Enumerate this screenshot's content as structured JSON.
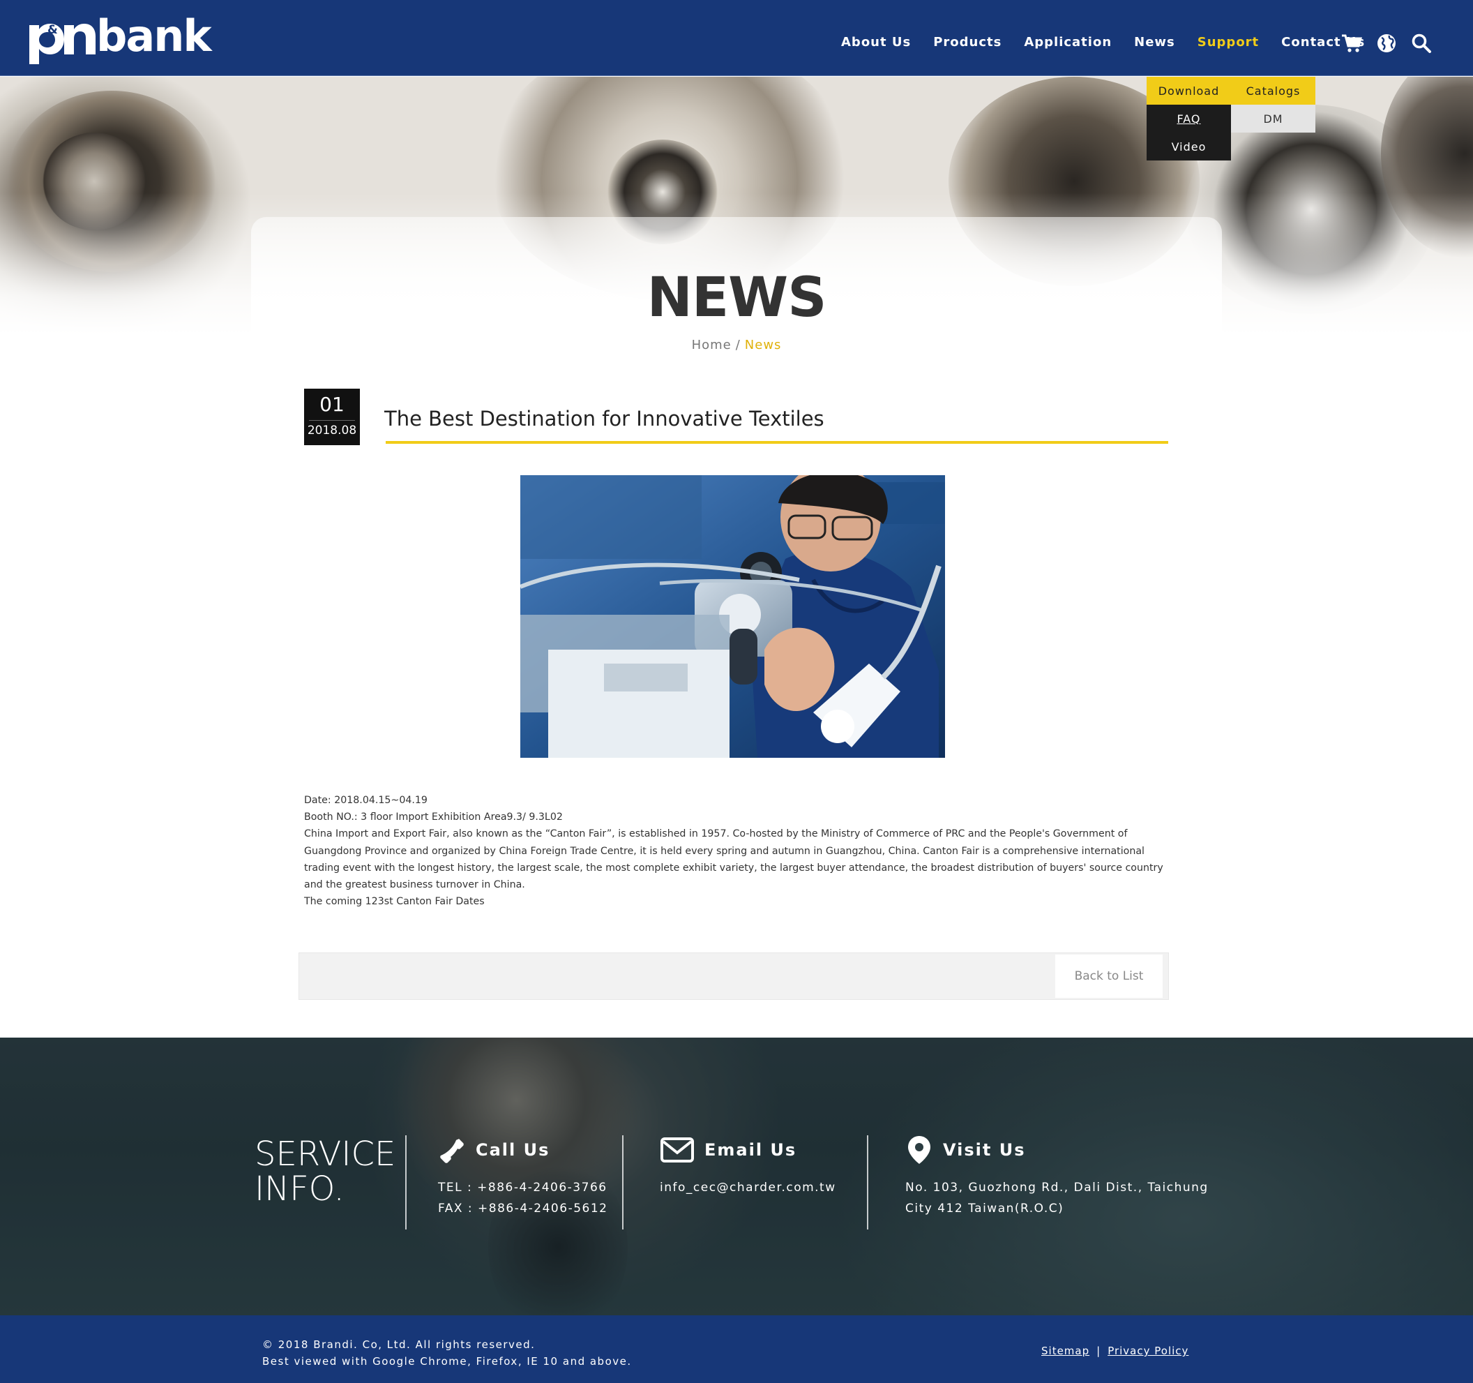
{
  "header": {
    "logo_text": "bank",
    "logo_mark": "p&n",
    "nav": [
      {
        "label": "About Us",
        "active": false
      },
      {
        "label": "Products",
        "active": false
      },
      {
        "label": "Application",
        "active": false
      },
      {
        "label": "News",
        "active": false
      },
      {
        "label": "Support",
        "active": true
      },
      {
        "label": "Contact Us",
        "active": false
      }
    ],
    "icons": [
      "cart-icon",
      "globe-icon",
      "search-icon"
    ]
  },
  "support_menu": {
    "download": "Download",
    "catalogs": "Catalogs",
    "faq": "FAQ",
    "dm": "DM",
    "video": "Video"
  },
  "page": {
    "title": "NEWS",
    "breadcrumb_home": "Home",
    "breadcrumb_sep": "/",
    "breadcrumb_current": "News"
  },
  "article": {
    "day": "01",
    "year_month": "2018.08",
    "title": "The Best Destination for Innovative Textiles",
    "body": [
      "Date: 2018.04.15~04.19",
      "Booth NO.: 3 floor Import Exhibition Area9.3/ 9.3L02",
      "China Import and Export Fair, also known as the “Canton Fair”, is established in 1957. Co-hosted by the Ministry of Commerce of PRC and the People's Government of Guangdong Province and organized by China Foreign Trade Centre, it is held every spring and autumn in Guangzhou, China. Canton Fair is a comprehensive international trading event with the longest history, the largest scale, the most complete exhibit variety, the largest buyer attendance, the broadest distribution of buyers' source country and the greatest business turnover in China.",
      "The coming 123st Canton Fair Dates"
    ],
    "back_label": "Back to List"
  },
  "service": {
    "title_line1": "SERVICE",
    "title_line2": "INFO.",
    "call": {
      "label": "Call Us",
      "tel": "TEL : +886-4-2406-3766",
      "fax": "FAX : +886-4-2406-5612"
    },
    "email": {
      "label": "Email Us",
      "address": "info_cec@charder.com.tw"
    },
    "visit": {
      "label": "Visit Us",
      "address_line1": "No. 103, Guozhong Rd., Dali Dist., Taichung",
      "address_line2": "City 412 Taiwan(R.O.C)"
    }
  },
  "footer": {
    "copyright": "© 2018 Brandi. Co, Ltd. All rights reserved.",
    "browsers": "Best viewed with Google Chrome, Firefox, IE 10 and above.",
    "sitemap": "Sitemap",
    "separator": "|",
    "privacy": "Privacy Policy"
  },
  "colors": {
    "brand_blue": "#173778",
    "accent_yellow": "#f1cc18",
    "dark": "#111111"
  }
}
